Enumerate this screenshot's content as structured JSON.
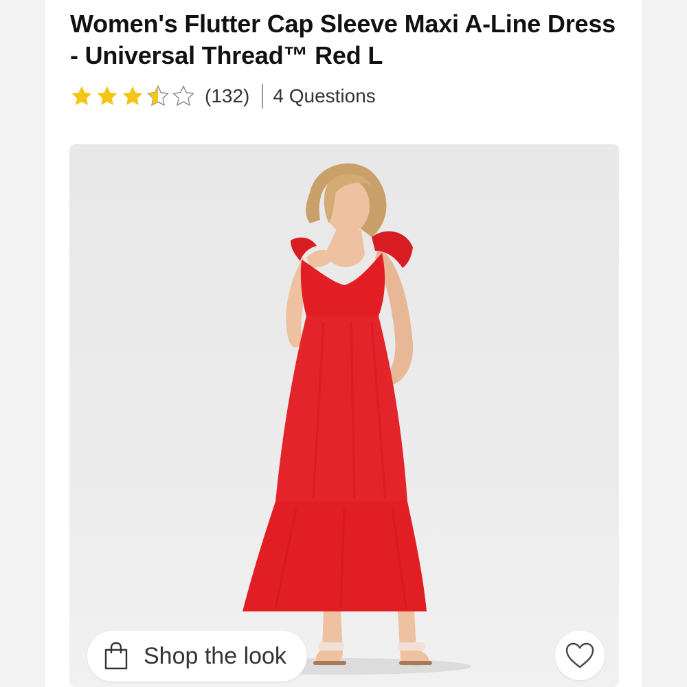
{
  "product": {
    "title": "Women's Flutter Cap Sleeve Maxi A-Line Dress - Universal Thread™ Red L"
  },
  "rating": {
    "value": 3.5,
    "max": 5,
    "count_label": "(132)",
    "questions_label": "4 Questions",
    "star_color": "#f5c518"
  },
  "image": {
    "alt": "Model wearing red flutter cap sleeve maxi dress with white sandals",
    "dress_color": "#e01e24"
  },
  "actions": {
    "shop_the_look_label": "Shop the look",
    "shop_icon": "shopping-bag-icon",
    "favorite_icon": "heart-icon"
  }
}
